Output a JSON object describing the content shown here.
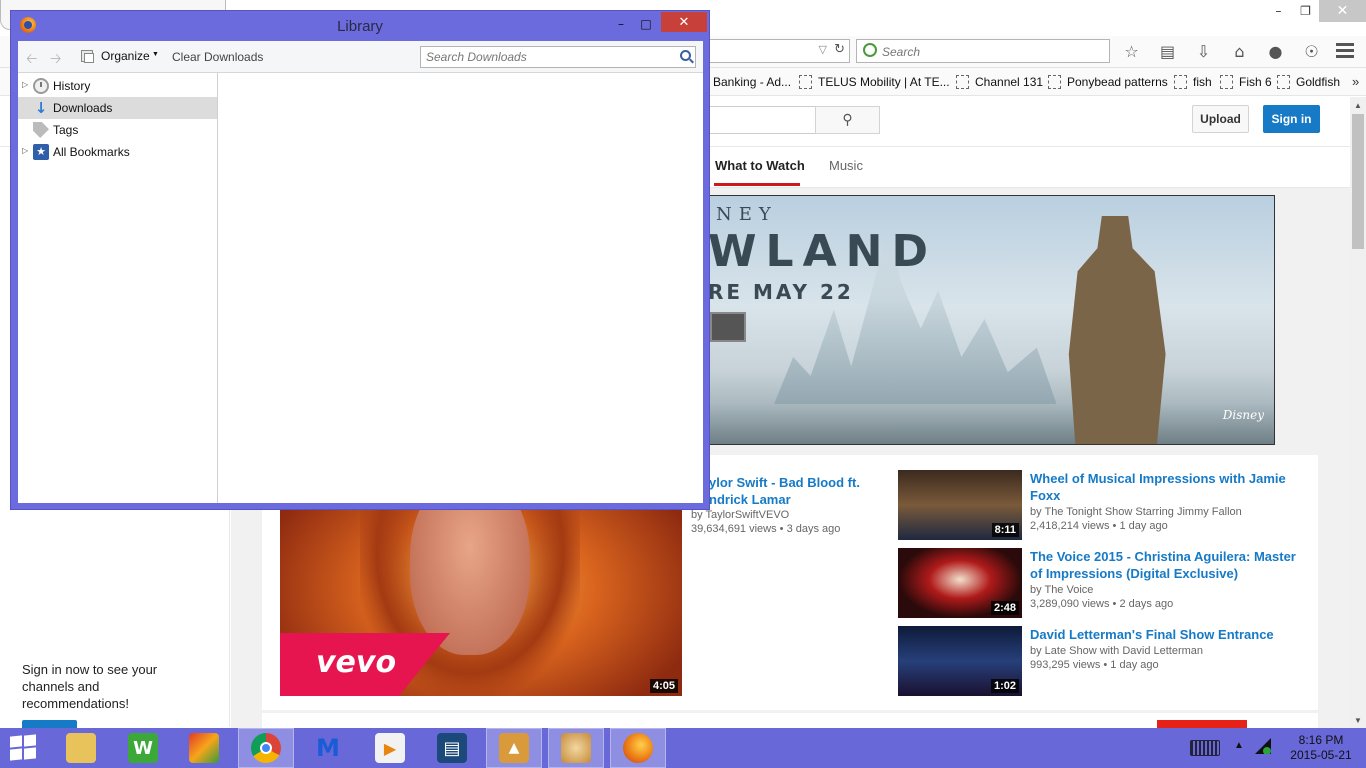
{
  "firefox": {
    "search_placeholder": "Search",
    "bookmarks": [
      "Banking - Ad...",
      "TELUS Mobility | At TE...",
      "Channel 131",
      "Ponybead patterns",
      "fish",
      "Fish 6",
      "Goldfish"
    ],
    "overflow": "»"
  },
  "youtube": {
    "upload_label": "Upload",
    "sign_in_label": "Sign in",
    "tabs": [
      "What to Watch",
      "Music"
    ],
    "banner": {
      "line1": "NEY",
      "line2": "WLAND",
      "line3": "RE MAY 22",
      "brand": "Disney"
    },
    "main_video": {
      "title": "ylor Swift - Bad Blood ft. ndrick Lamar",
      "channel": "by TaylorSwiftVEVO",
      "stats": "39,634,691 views  •  3 days ago",
      "duration": "4:05",
      "badge": "vevo"
    },
    "side_videos": [
      {
        "title": "Wheel of Musical Impressions with Jamie Foxx",
        "channel": "by The Tonight Show Starring Jimmy Fallon",
        "stats": "2,418,214 views  •  1 day ago",
        "duration": "8:11"
      },
      {
        "title": "The Voice 2015 - Christina Aguilera: Master of Impressions (Digital Exclusive)",
        "channel": "by The Voice",
        "stats": "3,289,090 views  •  2 days ago",
        "duration": "2:48"
      },
      {
        "title": "David Letterman's Final Show Entrance",
        "channel": "by Late Show with David Letterman",
        "stats": "993,295 views  •  1 day ago",
        "duration": "1:02"
      }
    ],
    "guide": {
      "message": "Sign in now to see your channels and recommendations!",
      "sign_in_label": "Sign in"
    }
  },
  "library": {
    "title": "Library",
    "organize_label": "Organize",
    "clear_downloads_label": "Clear Downloads",
    "search_placeholder": "Search Downloads",
    "tree": [
      {
        "label": "History",
        "icon": "history-icon"
      },
      {
        "label": "Downloads",
        "icon": "downloads-icon",
        "selected": true
      },
      {
        "label": "Tags",
        "icon": "tag-icon"
      },
      {
        "label": "All Bookmarks",
        "icon": "bookmarks-icon"
      }
    ]
  },
  "taskbar": {
    "apps": [
      "file-explorer",
      "wps-writer",
      "mosaic-app",
      "chrome",
      "malwarebytes",
      "media-player",
      "video-app",
      "cinema-app",
      "paint",
      "firefox"
    ],
    "time": "8:16 PM",
    "date": "2015-05-21"
  },
  "colors": {
    "taskbar": "#6868d8",
    "library_frame": "#6b6bde",
    "youtube_blue": "#167ac6",
    "youtube_red": "#cc181e"
  }
}
